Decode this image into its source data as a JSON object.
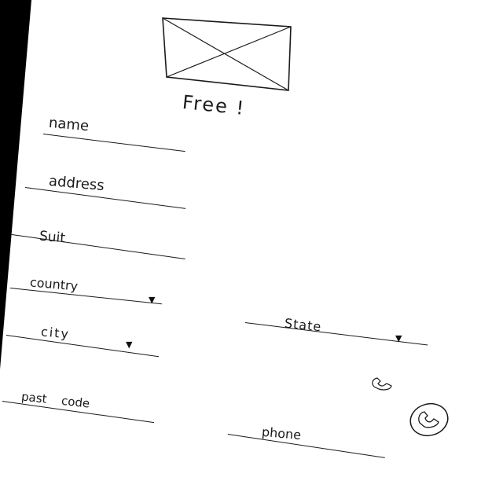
{
  "header": {
    "title": "Free !",
    "image_placeholder_icon": "image-placeholder-icon"
  },
  "form": {
    "name_label": "name",
    "address_label": "address",
    "suit_label": "Suit",
    "country_label": "country",
    "city_label": "city",
    "state_label": "State",
    "postcode_label": "past code",
    "phone_label": "phone",
    "dropdown_icon": "triangle-down-icon",
    "phone_icon": "phone-icon"
  },
  "colors": {
    "ink": "#1a1a1a",
    "paper": "#ffffff",
    "background": "#000000"
  }
}
